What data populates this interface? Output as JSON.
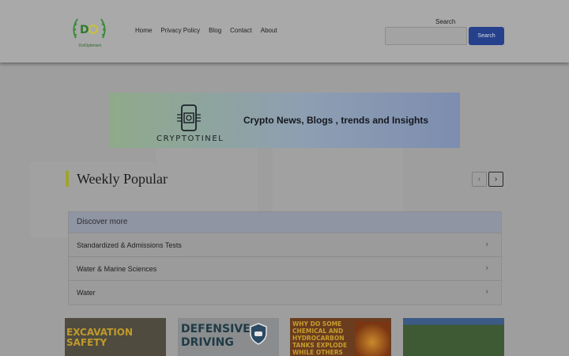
{
  "header": {
    "logo_text": "DotOptimism",
    "nav": [
      "Home",
      "Privacy Policy",
      "Blog",
      "Contact",
      "About"
    ],
    "search_label": "Search",
    "search_placeholder": "",
    "search_button": "Search"
  },
  "banner": {
    "brand": "CRYPTOTINEL",
    "title": "Crypto News, Blogs , trends and Insights"
  },
  "weekly": {
    "title": "Weekly Popular",
    "prev_icon": "chevron-left-icon",
    "next_icon": "chevron-right-icon"
  },
  "discover": {
    "heading": "Discover more",
    "items": [
      "Standardized & Admissions Tests",
      "Water & Marine Sciences",
      "Water"
    ]
  },
  "thumbnails": [
    {
      "text": "EXCAVATION SAFETY"
    },
    {
      "text": "DEFENSIVE DRIVING"
    },
    {
      "text": "WHY DO SOME CHEMICAL AND HYDROCARBON TANKS EXPLODE WHILE OTHERS DON'T?"
    },
    {
      "text": ""
    }
  ],
  "colors": {
    "accent": "#26418c",
    "weekly_bar": "#9da52a"
  }
}
